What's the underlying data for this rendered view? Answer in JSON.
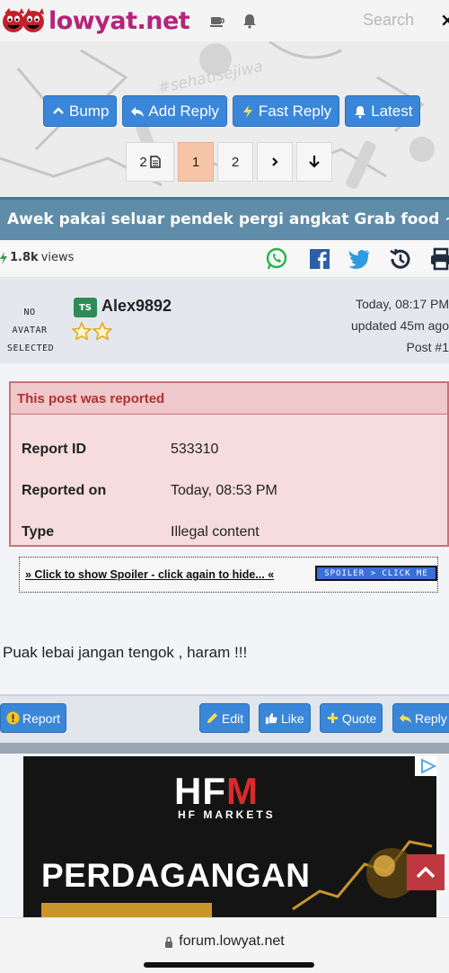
{
  "header": {
    "logo_text": "lowyat.net",
    "search_placeholder": "Search",
    "close_glyph": "×"
  },
  "banner": {
    "watermark_text": "#sehatisejiwa"
  },
  "toolbar": {
    "buttons": [
      {
        "label": "Bump",
        "icon": "chevron-up-icon"
      },
      {
        "label": "Add Reply",
        "icon": "reply-icon"
      },
      {
        "label": "Fast Reply",
        "icon": "bolt-icon"
      },
      {
        "label": "Latest",
        "icon": "bell-icon"
      }
    ]
  },
  "pagination": {
    "pages_count": "2",
    "current": "1",
    "next_page": "2"
  },
  "topic": {
    "title": "Awek pakai seluar pendek pergi angkat Grab food ~",
    "views_count": "1.8k",
    "views_label": "views"
  },
  "post": {
    "no_avatar_line1": "NO AVATAR",
    "no_avatar_line2": "SELECTED",
    "ts_badge": "TS",
    "username": "Alex9892",
    "time": "Today, 08:17 PM",
    "updated": "updated 45m ago",
    "post_label": "Post #1",
    "report": {
      "heading": "This post was reported",
      "rows": [
        {
          "key": "Report ID",
          "value": "533310"
        },
        {
          "key": "Reported on",
          "value": "Today, 08:53 PM"
        },
        {
          "key": "Type",
          "value": "Illegal content"
        }
      ]
    },
    "spoiler_text": "» Click to show Spoiler - click again to hide... «",
    "spoiler_image_text": "SPOILER > CLICK ME",
    "text": "Puak lebai jangan tengok , haram !!!"
  },
  "actions": {
    "report": "Report",
    "edit": "Edit",
    "like": "Like",
    "quote": "Quote",
    "reply": "Reply"
  },
  "ad": {
    "logo_main": "HF",
    "logo_accent": "M",
    "subtitle": "HF MARKETS",
    "headline": "PERDAGANGAN"
  },
  "browser": {
    "url": "forum.lowyat.net"
  },
  "colors": {
    "brand": "#b5247a",
    "button_blue": "#3a86d8",
    "title_bar": "#5f8ca8",
    "report_red": "#b23030"
  }
}
